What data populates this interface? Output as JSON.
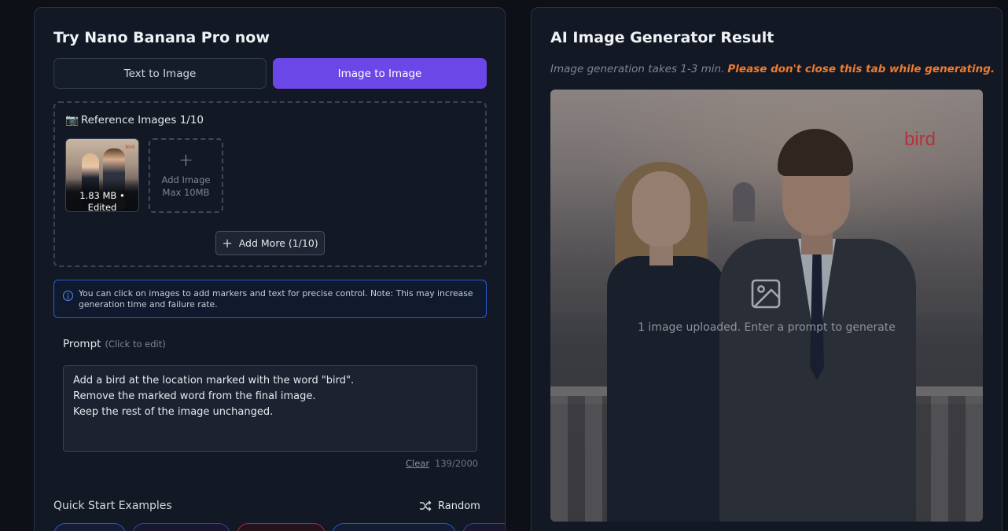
{
  "left_panel": {
    "title": "Try Nano Banana Pro now",
    "tabs": [
      {
        "label": "Text to Image",
        "active": false
      },
      {
        "label": "Image to Image",
        "active": true
      }
    ],
    "reference": {
      "camera_icon": "📷",
      "title": "Reference Images 1/10",
      "thumbnail": {
        "watermark": "bird",
        "size": "1.83 MB •",
        "status": "Edited"
      },
      "add_image": {
        "plus": "+",
        "label": "Add Image",
        "limit": "Max 10MB"
      },
      "add_more": {
        "plus": "+",
        "label": "Add More (1/10)"
      }
    },
    "info_note": "You can click on images to add markers and text for precise control. Note: This may increase generation time and failure rate.",
    "prompt": {
      "label": "Prompt",
      "hint": "(Click to edit)",
      "value": "Add a bird at the location marked with the word \"bird\".\nRemove the marked word from the final image.\nKeep the rest of the image unchanged.",
      "clear_label": "Clear",
      "counter": "139/2000"
    },
    "quick_start": {
      "title": "Quick Start Examples",
      "random_label": "Random"
    }
  },
  "right_panel": {
    "title": "AI Image Generator Result",
    "note": "Image generation takes 1-3 min.",
    "warning": "Please don't close this tab while generating.",
    "result": {
      "marker_text": "bird",
      "status_text": "1 image uploaded. Enter a prompt to generate"
    }
  },
  "colors": {
    "accent": "#6c47e8",
    "warning": "#f07a2d",
    "info_border": "#2b5cd6",
    "marker": "#b3343d"
  }
}
